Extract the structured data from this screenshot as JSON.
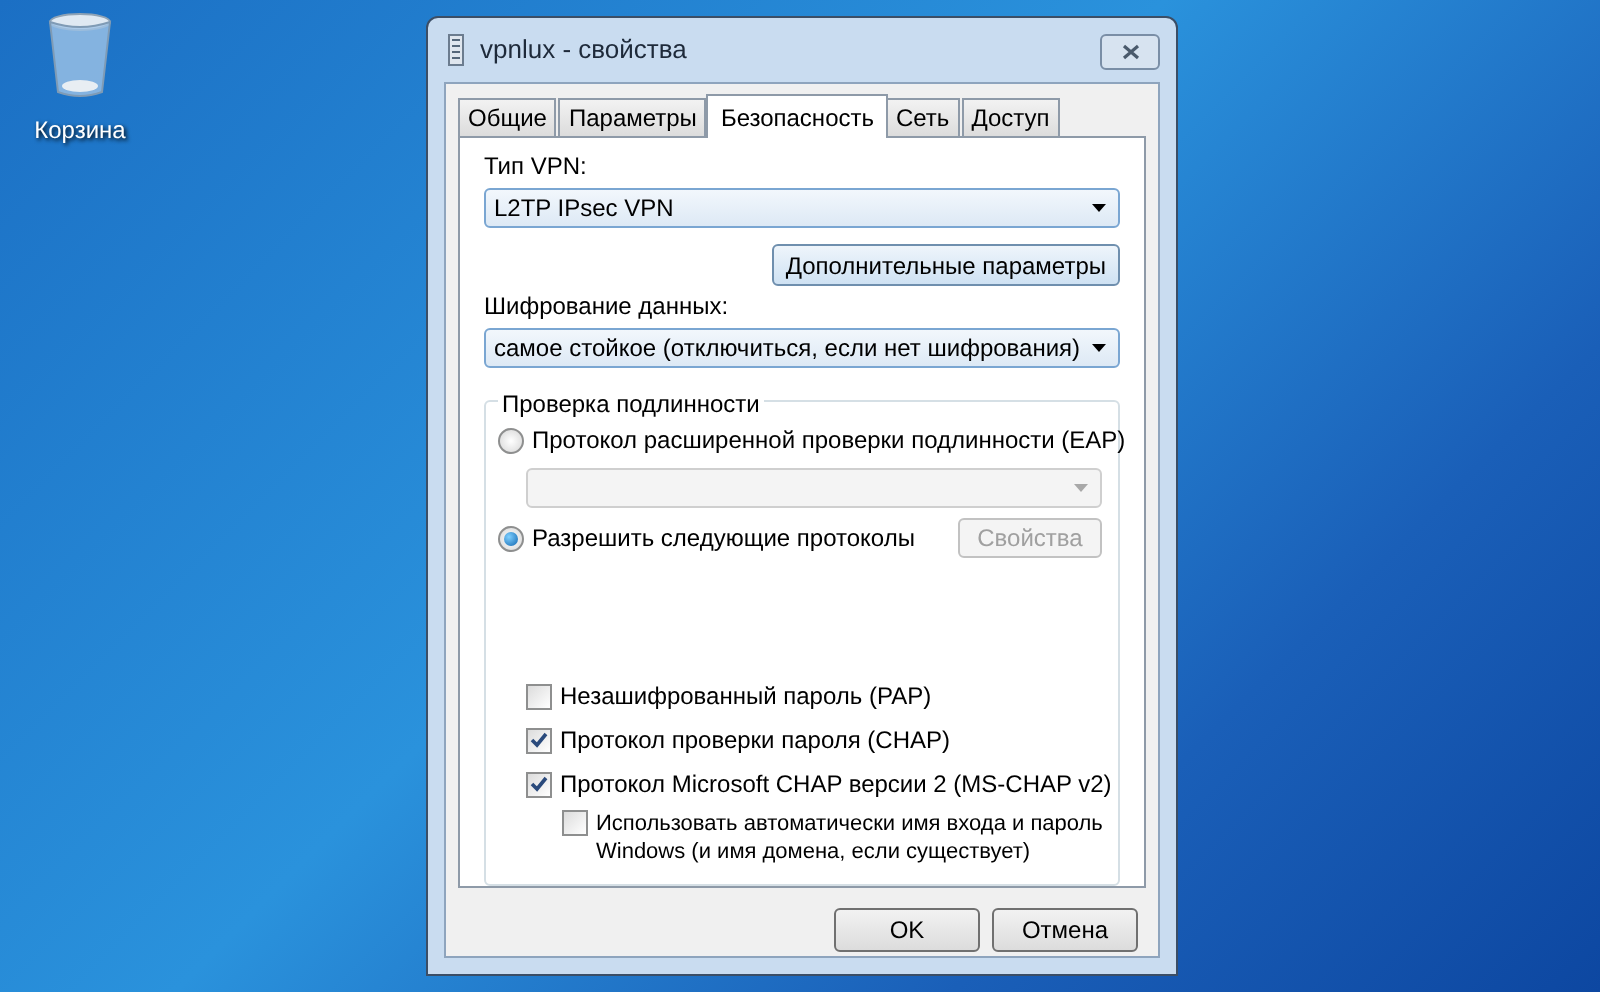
{
  "desktop_icons": [
    {
      "label": "Корзина"
    }
  ],
  "window": {
    "title": "vpnlux - свойства",
    "tabs": [
      {
        "label": "Общие",
        "selected": false
      },
      {
        "label": "Параметры",
        "selected": false
      },
      {
        "label": "Безопасность",
        "selected": true
      },
      {
        "label": "Сеть",
        "selected": false
      },
      {
        "label": "Доступ",
        "selected": false
      }
    ],
    "vpn_type": {
      "label": "Тип VPN:",
      "value": "L2TP IPsec VPN"
    },
    "advanced_button": "Дополнительные параметры",
    "encryption": {
      "label": "Шифрование данных:",
      "value": "самое стойкое (отключиться, если нет шифрования)"
    },
    "authentication": {
      "title": "Проверка подлинности",
      "radios": [
        {
          "label": "Протокол расширенной проверки подлинности (EAP)",
          "selected": false
        },
        {
          "label": "Разрешить следующие протоколы",
          "selected": true
        }
      ],
      "eap_dropdown": {
        "disabled": true
      },
      "properties_button": {
        "label": "Свойства",
        "disabled": true
      },
      "checkboxes": [
        {
          "label": "Незашифрованный пароль (PAP)",
          "checked": false
        },
        {
          "label": "Протокол проверки пароля (CHAP)",
          "checked": true
        },
        {
          "label": "Протокол Microsoft CHAP версии 2 (MS-CHAP v2)",
          "checked": true,
          "children": [
            {
              "label": "Использовать автоматически имя входа и пароль Windows (и имя домена, если существует)",
              "checked": false
            }
          ]
        }
      ]
    },
    "buttons": [
      "OK",
      "Отмена"
    ]
  }
}
